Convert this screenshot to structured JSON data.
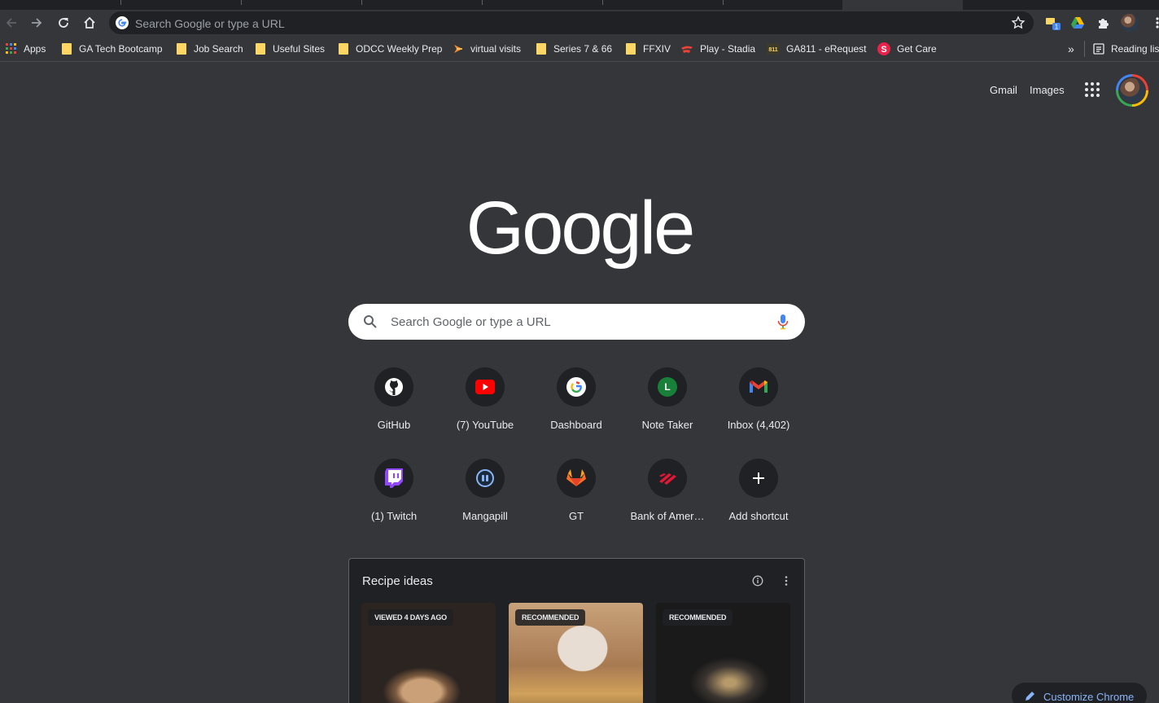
{
  "toolbar": {
    "omnibox_placeholder": "Search Google or type a URL"
  },
  "bookmarks": {
    "items": [
      {
        "label": "Apps",
        "icon": "apps-grid-icon"
      },
      {
        "label": "GA Tech Bootcamp",
        "icon": "folder-icon"
      },
      {
        "label": "Job Search",
        "icon": "folder-icon"
      },
      {
        "label": "Useful Sites",
        "icon": "folder-icon"
      },
      {
        "label": "ODCC Weekly Prep",
        "icon": "folder-icon"
      },
      {
        "label": "virtual visits",
        "icon": "virtual-visits-icon"
      },
      {
        "label": "Series 7 & 66",
        "icon": "folder-icon"
      },
      {
        "label": "FFXIV",
        "icon": "folder-icon"
      },
      {
        "label": "Play - Stadia",
        "icon": "stadia-icon"
      },
      {
        "label": "GA811 - eRequest",
        "icon": "ga811-icon"
      },
      {
        "label": "Get Care",
        "icon": "get-care-icon"
      }
    ],
    "overflow": "»",
    "reading_list": "Reading list"
  },
  "header": {
    "gmail": "Gmail",
    "images": "Images"
  },
  "logo": "Google",
  "search": {
    "placeholder": "Search Google or type a URL"
  },
  "shortcuts": [
    {
      "label": "GitHub",
      "icon": "github-icon"
    },
    {
      "label": "(7) YouTube",
      "icon": "youtube-icon"
    },
    {
      "label": "Dashboard",
      "icon": "google-icon"
    },
    {
      "label": "Note Taker",
      "icon": "note-taker-icon",
      "letter": "L"
    },
    {
      "label": "Inbox (4,402)",
      "icon": "gmail-icon"
    },
    {
      "label": "(1) Twitch",
      "icon": "twitch-icon"
    },
    {
      "label": "Mangapill",
      "icon": "mangapill-icon"
    },
    {
      "label": "GT",
      "icon": "gitlab-icon"
    },
    {
      "label": "Bank of Amer…",
      "icon": "bank-of-america-icon"
    },
    {
      "label": "Add shortcut",
      "icon": "plus-icon"
    }
  ],
  "recipes": {
    "title": "Recipe ideas",
    "tiles": [
      {
        "badge": "VIEWED 4 DAYS AGO"
      },
      {
        "badge": "RECOMMENDED"
      },
      {
        "badge": "RECOMMENDED"
      }
    ]
  },
  "customize": {
    "label": "Customize Chrome"
  },
  "colors": {
    "background": "#35363a",
    "surface": "#202124",
    "accent_link": "#8ab4f8"
  }
}
